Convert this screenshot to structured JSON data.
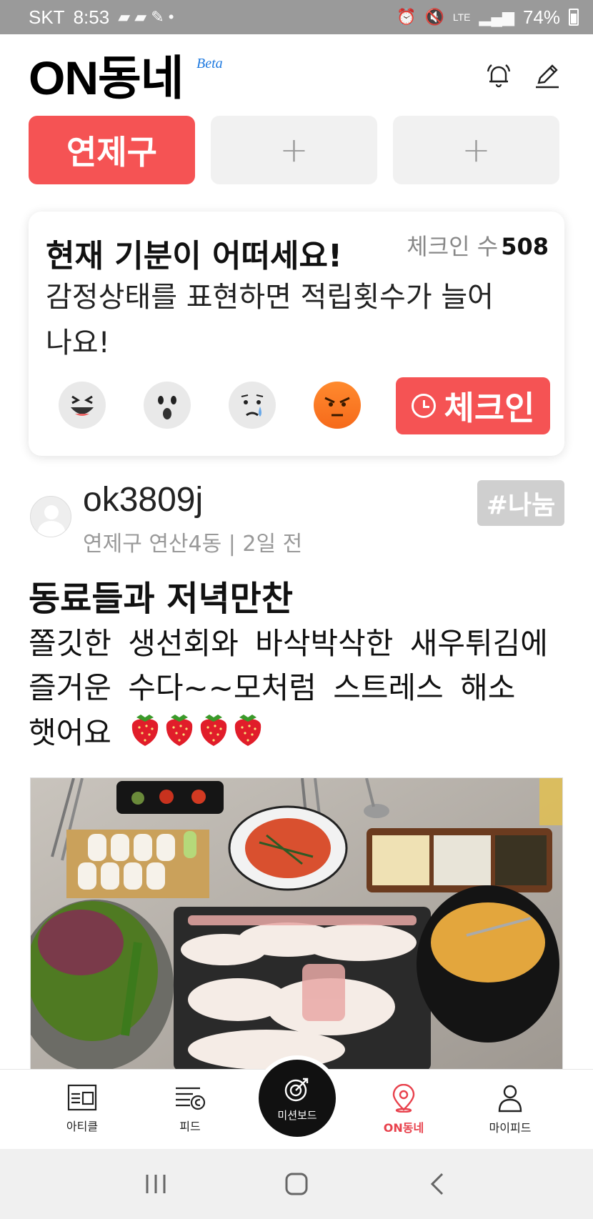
{
  "status_bar": {
    "carrier": "SKT",
    "time": "8:53",
    "battery": "74%",
    "network": "LTE"
  },
  "header": {
    "app_title": "ON동네",
    "beta_label": "Beta",
    "icons": [
      "bell-icon",
      "pencil-icon"
    ]
  },
  "regions": {
    "tabs": [
      {
        "label": "연제구",
        "active": true
      },
      {
        "label": "+",
        "active": false
      },
      {
        "label": "+",
        "active": false
      }
    ]
  },
  "mood_card": {
    "title": "현재 기분이 어떠세요!",
    "checkin_count_label": "체크인 수",
    "checkin_count": "508",
    "description": "감정상태를 표현하면 적립횟수가 늘어나요!",
    "emotes": [
      "laughing-emoji",
      "surprised-emoji",
      "crying-emoji",
      "angry-emoji"
    ],
    "checkin_button": "체크인"
  },
  "post": {
    "username": "ok3809j",
    "meta": "연제구 연산4동 | 2일 전",
    "tag": "#나눔",
    "title": "동료들과 저녁만찬",
    "body_text": "쫄깃한 생선회와 바삭박삭한 새우튀김에즐거운 수다~~모처럼 스트레스 해소 햇어요",
    "body_emoji_count": 4
  },
  "bottom_nav": {
    "items": [
      {
        "label": "아티클",
        "icon": "article-icon",
        "active": false
      },
      {
        "label": "피드",
        "icon": "feed-icon",
        "active": false
      },
      {
        "label": "미션보드",
        "icon": "target-icon",
        "active": false
      },
      {
        "label": "ON동네",
        "icon": "location-pin-icon",
        "active": true
      },
      {
        "label": "마이피드",
        "icon": "person-icon",
        "active": false
      }
    ]
  },
  "colors": {
    "accent": "#f55354",
    "active_nav": "#e8414c",
    "beta": "#1f7ae0"
  }
}
